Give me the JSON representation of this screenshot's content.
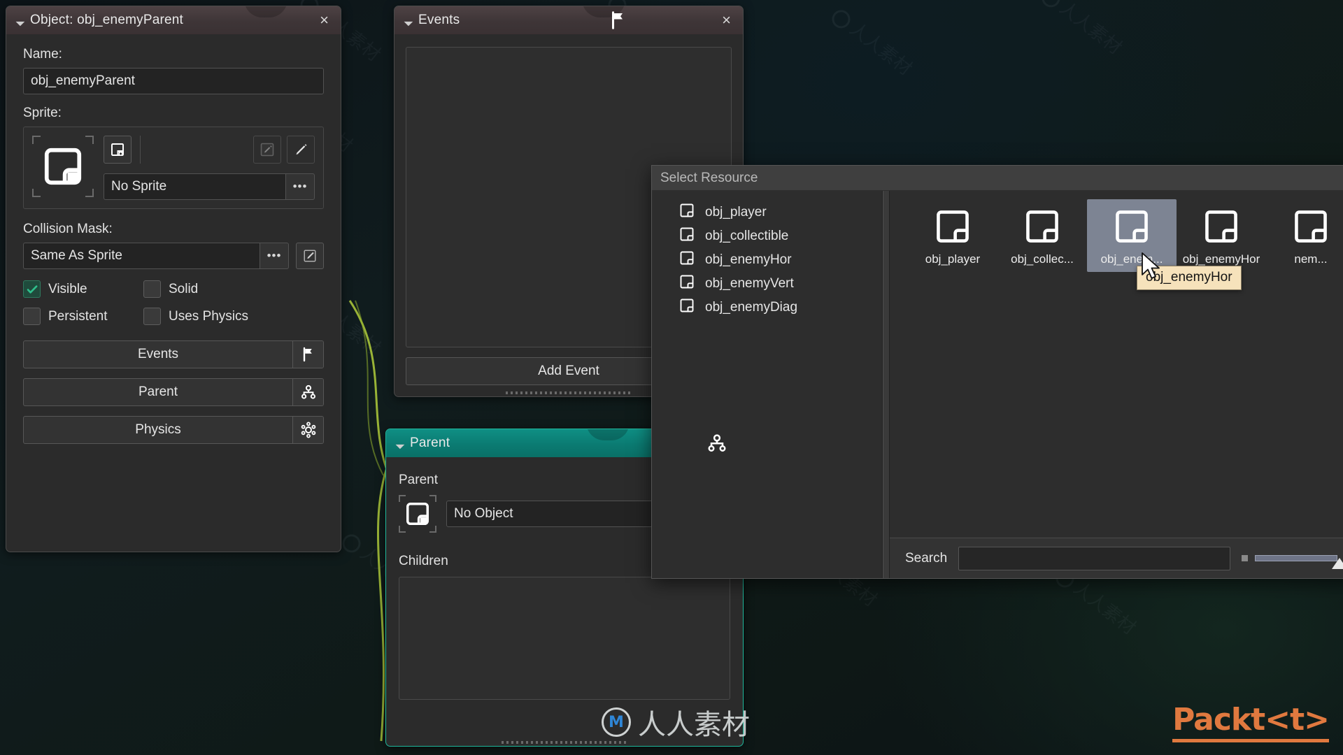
{
  "object_panel": {
    "title": "Object: obj_enemyParent",
    "close_label": "×",
    "name_label": "Name:",
    "name_value": "obj_enemyParent",
    "sprite_label": "Sprite:",
    "sprite_value": "No Sprite",
    "sprite_ellipsis": "•••",
    "collision_label": "Collision Mask:",
    "collision_value": "Same As Sprite",
    "collision_ellipsis": "•••",
    "checkboxes": [
      {
        "label": "Visible",
        "checked": true
      },
      {
        "label": "Solid",
        "checked": false
      },
      {
        "label": "Persistent",
        "checked": false
      },
      {
        "label": "Uses Physics",
        "checked": false
      }
    ],
    "buttons": [
      {
        "label": "Events",
        "icon": "flag-icon"
      },
      {
        "label": "Parent",
        "icon": "hierarchy-icon"
      },
      {
        "label": "Physics",
        "icon": "physics-gear-icon"
      }
    ]
  },
  "events_panel": {
    "title": "Events",
    "icon": "flag-icon",
    "close_label": "×",
    "add_event_label": "Add Event"
  },
  "parent_panel": {
    "title": "Parent",
    "icon": "hierarchy-icon",
    "parent_label": "Parent",
    "parent_value": "No Object",
    "children_label": "Children",
    "children_icon": "info-icon"
  },
  "select_resource": {
    "title": "Select Resource",
    "list_items": [
      {
        "label": "obj_player"
      },
      {
        "label": "obj_collectible"
      },
      {
        "label": "obj_enemyHor"
      },
      {
        "label": "obj_enemyVert"
      },
      {
        "label": "obj_enemyDiag"
      }
    ],
    "thumbnails": [
      {
        "label": "obj_player",
        "selected": false
      },
      {
        "label": "obj_collec...",
        "selected": false
      },
      {
        "label": "obj_enem...",
        "selected": true
      },
      {
        "label": "obj_enemyHor",
        "selected": false
      },
      {
        "label": "nem...",
        "selected": false
      }
    ],
    "search_label": "Search",
    "search_value": "",
    "search_placeholder": ""
  },
  "tooltip": {
    "text": "obj_enemyHor"
  },
  "branding": {
    "packt_logo": "Packt",
    "packt_suffix": "<t>",
    "watermark_text": "人人素材",
    "watermark_mark": "M"
  },
  "colors": {
    "accent_teal": "#0f8f84",
    "accent_green_check": "#2fc08c",
    "selection_blue": "#7d8493",
    "tooltip_bg": "#f6e2bb",
    "packt_orange": "#e0793f",
    "connector_green": "#a8c43a"
  }
}
